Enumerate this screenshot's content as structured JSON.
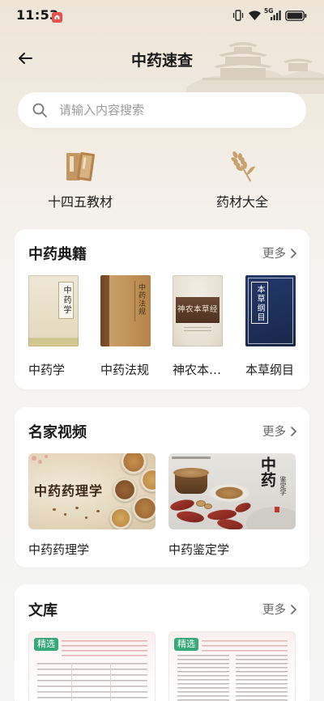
{
  "status_bar": {
    "time": "11:53",
    "network_label": "5G",
    "icons": [
      "notification-app-icon",
      "vibrate-icon",
      "wifi-icon",
      "signal-icon",
      "battery-icon"
    ]
  },
  "header": {
    "title": "中药速查",
    "back_icon": "arrow-left-icon"
  },
  "search": {
    "placeholder": "请输入内容搜索",
    "value": "",
    "icon": "search-icon"
  },
  "categories": [
    {
      "label": "十四五教材",
      "icon": "textbook-icon"
    },
    {
      "label": "药材大全",
      "icon": "wheat-herb-icon"
    }
  ],
  "classics": {
    "title": "中药典籍",
    "more_label": "更多",
    "books": [
      {
        "label": "中药学",
        "cover_text": "中药学"
      },
      {
        "label": "中药法规",
        "cover_text": "中药法规"
      },
      {
        "label": "神农本…",
        "cover_text": "神农本草经"
      },
      {
        "label": "本草纲目",
        "cover_text": "本草纲目"
      }
    ]
  },
  "videos": {
    "title": "名家视频",
    "more_label": "更多",
    "items": [
      {
        "label": "中药药理学",
        "thumb_text": "中药药理学"
      },
      {
        "label": "中药鉴定学",
        "thumb_calligraphy": "中药",
        "thumb_subtitle": "鉴定学"
      }
    ]
  },
  "library": {
    "title": "文库",
    "more_label": "更多",
    "items": [
      {
        "badge": "精选"
      },
      {
        "badge": "精选"
      }
    ]
  },
  "colors": {
    "background_top": "#eee5d7",
    "background": "#f5f5f5",
    "card": "#ffffff",
    "text_primary": "#1f1f1f",
    "text_secondary": "#666666",
    "placeholder": "#9a9a9a",
    "icon_brown": "#c29a68",
    "badge_green": "#35a97a",
    "notification_red": "#e4524c"
  }
}
